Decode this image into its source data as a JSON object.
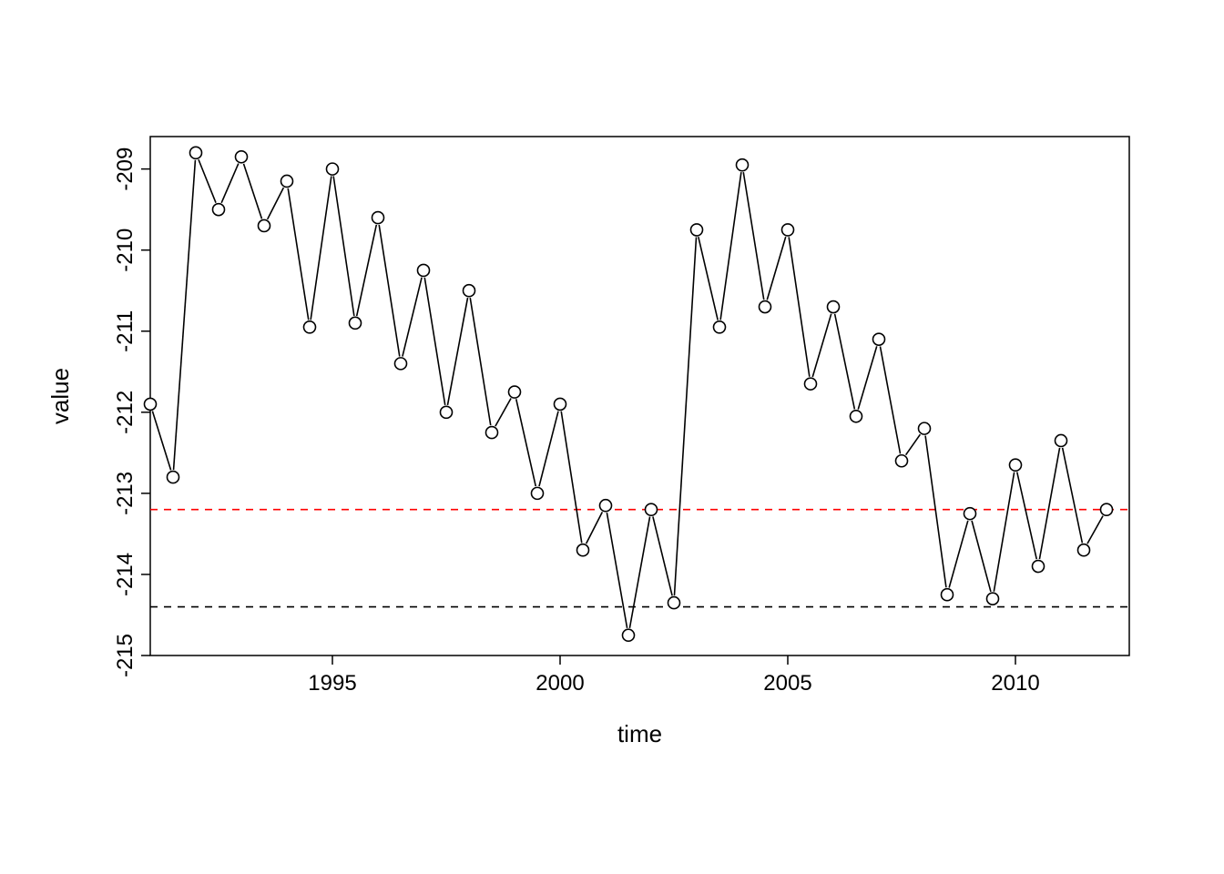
{
  "chart_data": {
    "type": "line",
    "xlabel": "time",
    "ylabel": "value",
    "xlim": [
      1991.0,
      2012.5
    ],
    "ylim": [
      -215.0,
      -208.6
    ],
    "x_ticks": [
      1995,
      2000,
      2005,
      2010
    ],
    "y_ticks": [
      -215,
      -214,
      -213,
      -212,
      -211,
      -210,
      -209
    ],
    "x": [
      1991.0,
      1991.5,
      1992.0,
      1992.5,
      1993.0,
      1993.5,
      1994.0,
      1994.5,
      1995.0,
      1995.5,
      1996.0,
      1996.5,
      1997.0,
      1997.5,
      1998.0,
      1998.5,
      1999.0,
      1999.5,
      2000.0,
      2000.5,
      2001.0,
      2001.5,
      2002.0,
      2002.5,
      2003.0,
      2003.5,
      2004.0,
      2004.5,
      2005.0,
      2005.5,
      2006.0,
      2006.5,
      2007.0,
      2007.5,
      2008.0,
      2008.5,
      2009.0,
      2009.5,
      2010.0,
      2010.5,
      2011.0,
      2011.5,
      2012.0
    ],
    "values": [
      -211.9,
      -212.8,
      -208.8,
      -209.5,
      -208.85,
      -209.7,
      -209.15,
      -210.95,
      -209.0,
      -210.9,
      -209.6,
      -211.4,
      -210.25,
      -212.0,
      -210.5,
      -212.25,
      -211.75,
      -213.0,
      -211.9,
      -213.7,
      -213.15,
      -214.75,
      -213.2,
      -214.35,
      -209.75,
      -210.95,
      -208.95,
      -210.7,
      -209.75,
      -211.65,
      -210.7,
      -212.05,
      -211.1,
      -212.6,
      -212.2,
      -214.25,
      -213.25,
      -214.3,
      -212.65,
      -213.9,
      -212.35,
      -213.7,
      -213.2
    ],
    "reference_lines": [
      {
        "value": -213.2,
        "color": "#ff0000",
        "style": "dashed"
      },
      {
        "value": -214.4,
        "color": "#000000",
        "style": "dashed"
      }
    ],
    "marker": "open-circle",
    "line_color": "#000000"
  }
}
